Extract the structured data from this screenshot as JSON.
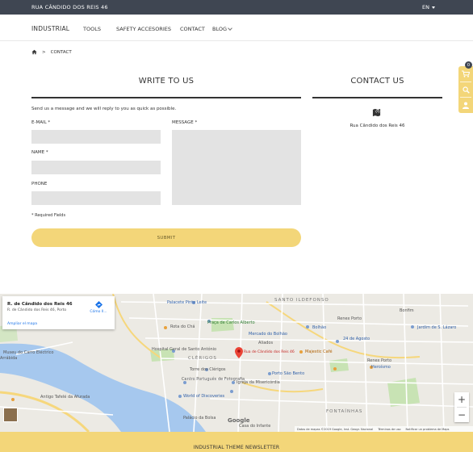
{
  "topbar": {
    "address": "RUA CÂNDIDO DOS REIS 46",
    "language": "EN"
  },
  "nav": {
    "logo": "INDUSTRIAL",
    "items": [
      "TOOLS",
      "SAFETY ACCESORIES",
      "CONTACT",
      "BLOG"
    ]
  },
  "breadcrumb": {
    "current": "CONTACT"
  },
  "form": {
    "title": "WRITE TO US",
    "intro": "Send us a message and we will reply to you as quick as possible.",
    "email_label": "E-MAIL *",
    "name_label": "NAME *",
    "phone_label": "PHONE",
    "message_label": "MESSAGE *",
    "required_note": "* Required Fields",
    "submit_label": "SUBMIT"
  },
  "contact": {
    "title": "CONTACT US",
    "address": "Rua Cândido dos Reis 46"
  },
  "side": {
    "cart_count": "0"
  },
  "map": {
    "card_title": "R. de Cândido dos Reis 46",
    "card_subtitle": "R. de Cândido dos Reis 46, Porto",
    "card_link": "Ampliar el mapa",
    "directions": "Cómo ll...",
    "pin_label": "Rua de Cândido dos Reis 46",
    "labels": {
      "palacete": "Palacete Pinto Leite",
      "rota": "Rota do Chá",
      "praca": "Praça de Carlos Alberto",
      "mercado": "Mercado do Bolhão",
      "hospital": "Hospital Geral de Santo António",
      "clerigos": "CLÉRIGOS",
      "torre": "Torre dos Clérigos",
      "majestic": "Majestic Café",
      "aliados": "Aliados",
      "bolhao": "Bolhão",
      "centro": "Centro Português de Fotografia",
      "saobento": "Porto São Bento",
      "igreja": "Igreja da Misericórdia",
      "world": "World of Discoveries",
      "palacio": "Palácio da Bolsa",
      "casa": "Casa do Infante",
      "sagosto": "24 de Agosto",
      "heroismo": "Heroísmo",
      "fontainhas": "FONTAÍNHAS",
      "bonfim": "Bonfim",
      "renex": "Renex Porto",
      "antigo": "Antigo Tafelé da Afurada",
      "museu": "Museu do Carro Eléctrico",
      "santo": "SANTO ILDEFONSO",
      "lazaro": "Jardim de S. Lázaro",
      "arvora": "Arrábida"
    },
    "attribution": [
      "Datos de mapas ©2019 Google, Inst. Geogr. Nacional",
      "Términos de uso",
      "Notificar un problema de Maps"
    ],
    "google": "Google"
  },
  "newsletter": {
    "title": "INDUSTRIAL THEME NEWSLETTER"
  }
}
